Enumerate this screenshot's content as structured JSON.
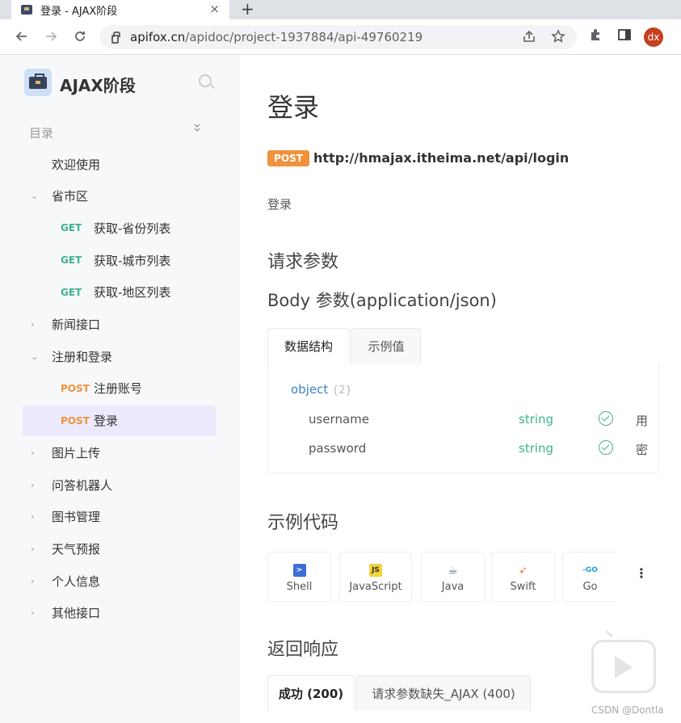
{
  "browser": {
    "tab_title": "登录 - AJAX阶段",
    "close_glyph": "×",
    "new_tab_glyph": "+",
    "url_host": "apifox.cn",
    "url_path": "/apidoc/project-1937884/api-49760219",
    "avatar_text": "dx"
  },
  "sidebar": {
    "project_title": "AJAX阶段",
    "toc_label": "目录",
    "items": [
      {
        "label": "欢迎使用",
        "caret": "",
        "method": ""
      },
      {
        "label": "省市区",
        "caret": "⌄",
        "method": ""
      },
      {
        "label": "获取-省份列表",
        "caret": "",
        "method": "GET"
      },
      {
        "label": "获取-城市列表",
        "caret": "",
        "method": "GET"
      },
      {
        "label": "获取-地区列表",
        "caret": "",
        "method": "GET"
      },
      {
        "label": "新闻接口",
        "caret": "›",
        "method": ""
      },
      {
        "label": "注册和登录",
        "caret": "⌄",
        "method": ""
      },
      {
        "label": "注册账号",
        "caret": "",
        "method": "POST"
      },
      {
        "label": "登录",
        "caret": "",
        "method": "POST",
        "active": true
      },
      {
        "label": "图片上传",
        "caret": "›",
        "method": ""
      },
      {
        "label": "问答机器人",
        "caret": "›",
        "method": ""
      },
      {
        "label": "图书管理",
        "caret": "›",
        "method": ""
      },
      {
        "label": "天气预报",
        "caret": "›",
        "method": ""
      },
      {
        "label": "个人信息",
        "caret": "›",
        "method": ""
      },
      {
        "label": "其他接口",
        "caret": "›",
        "method": ""
      }
    ]
  },
  "main": {
    "title": "登录",
    "method": "POST",
    "url": "http://hmajax.itheima.net/api/login",
    "description": "登录",
    "request_params_heading": "请求参数",
    "body_heading": "Body 参数(application/json)",
    "schema_tabs": [
      "数据结构",
      "示例值"
    ],
    "schema": {
      "root_type": "object",
      "root_count": "{2}",
      "fields": [
        {
          "name": "username",
          "type": "string",
          "desc": "用"
        },
        {
          "name": "password",
          "type": "string",
          "desc": "密"
        }
      ]
    },
    "example_heading": "示例代码",
    "code_langs": [
      {
        "name": "Shell",
        "icon": "shell-icon",
        "color": "#3d6ed8"
      },
      {
        "name": "JavaScript",
        "icon": "javascript-icon",
        "color": "#f2d33b"
      },
      {
        "name": "Java",
        "icon": "java-icon",
        "color": "#5f7d9c"
      },
      {
        "name": "Swift",
        "icon": "swift-icon",
        "color": "#f0704a"
      },
      {
        "name": "Go",
        "icon": "go-icon",
        "color": "#2a9fd6"
      }
    ],
    "more_glyph": "⋮",
    "response_heading": "返回响应",
    "response_tabs": [
      "成功 (200)",
      "请求参数缺失_AJAX (400)"
    ]
  },
  "watermark": "CSDN @Dontla",
  "colors": {
    "get": "#3fb28f",
    "post": "#f0923d",
    "active_bg": "#ebe9fb",
    "accent_link": "#3b82c4"
  }
}
